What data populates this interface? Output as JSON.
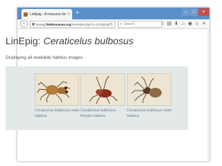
{
  "browser": {
    "tab_title": "LinEpig - A resource for ID ...",
    "tab_close": "×",
    "new_tab": "+",
    "window_controls": {
      "minimize": "–",
      "maximize": "□",
      "close": "×"
    },
    "back": "‹",
    "url_prefix": "linepig.",
    "url_domain": "fieldmuseum.org",
    "url_path": "/mem/dev.php?n=2A2353M",
    "reload": "↻",
    "search_placeholder": "Search",
    "search_glyph": "⌕",
    "toolbar_icons": [
      "☆",
      "▤",
      "⬇",
      "⌂",
      "◉",
      "☺",
      "≡"
    ]
  },
  "page": {
    "title_prefix": "LinEpig: ",
    "title_species": "Ceraticelus bulbosus",
    "subtitle": "Displaying all available habitus images."
  },
  "gallery": {
    "items": [
      {
        "caption": "Ceraticelus bulbosus male habitus",
        "icon": "spider-dorsal-image"
      },
      {
        "caption": "Ceraticelus bulbosus female habitus",
        "icon": "spider-lateral-image"
      },
      {
        "caption": "Ceraticelus bulbosus male habitus",
        "icon": "spider-ventral-image"
      }
    ]
  },
  "colors": {
    "tabbar": "#5b8fc9",
    "gallery_bg": "#e2e9e8",
    "caption": "#6b7e83",
    "title": "#3f3f3f"
  }
}
